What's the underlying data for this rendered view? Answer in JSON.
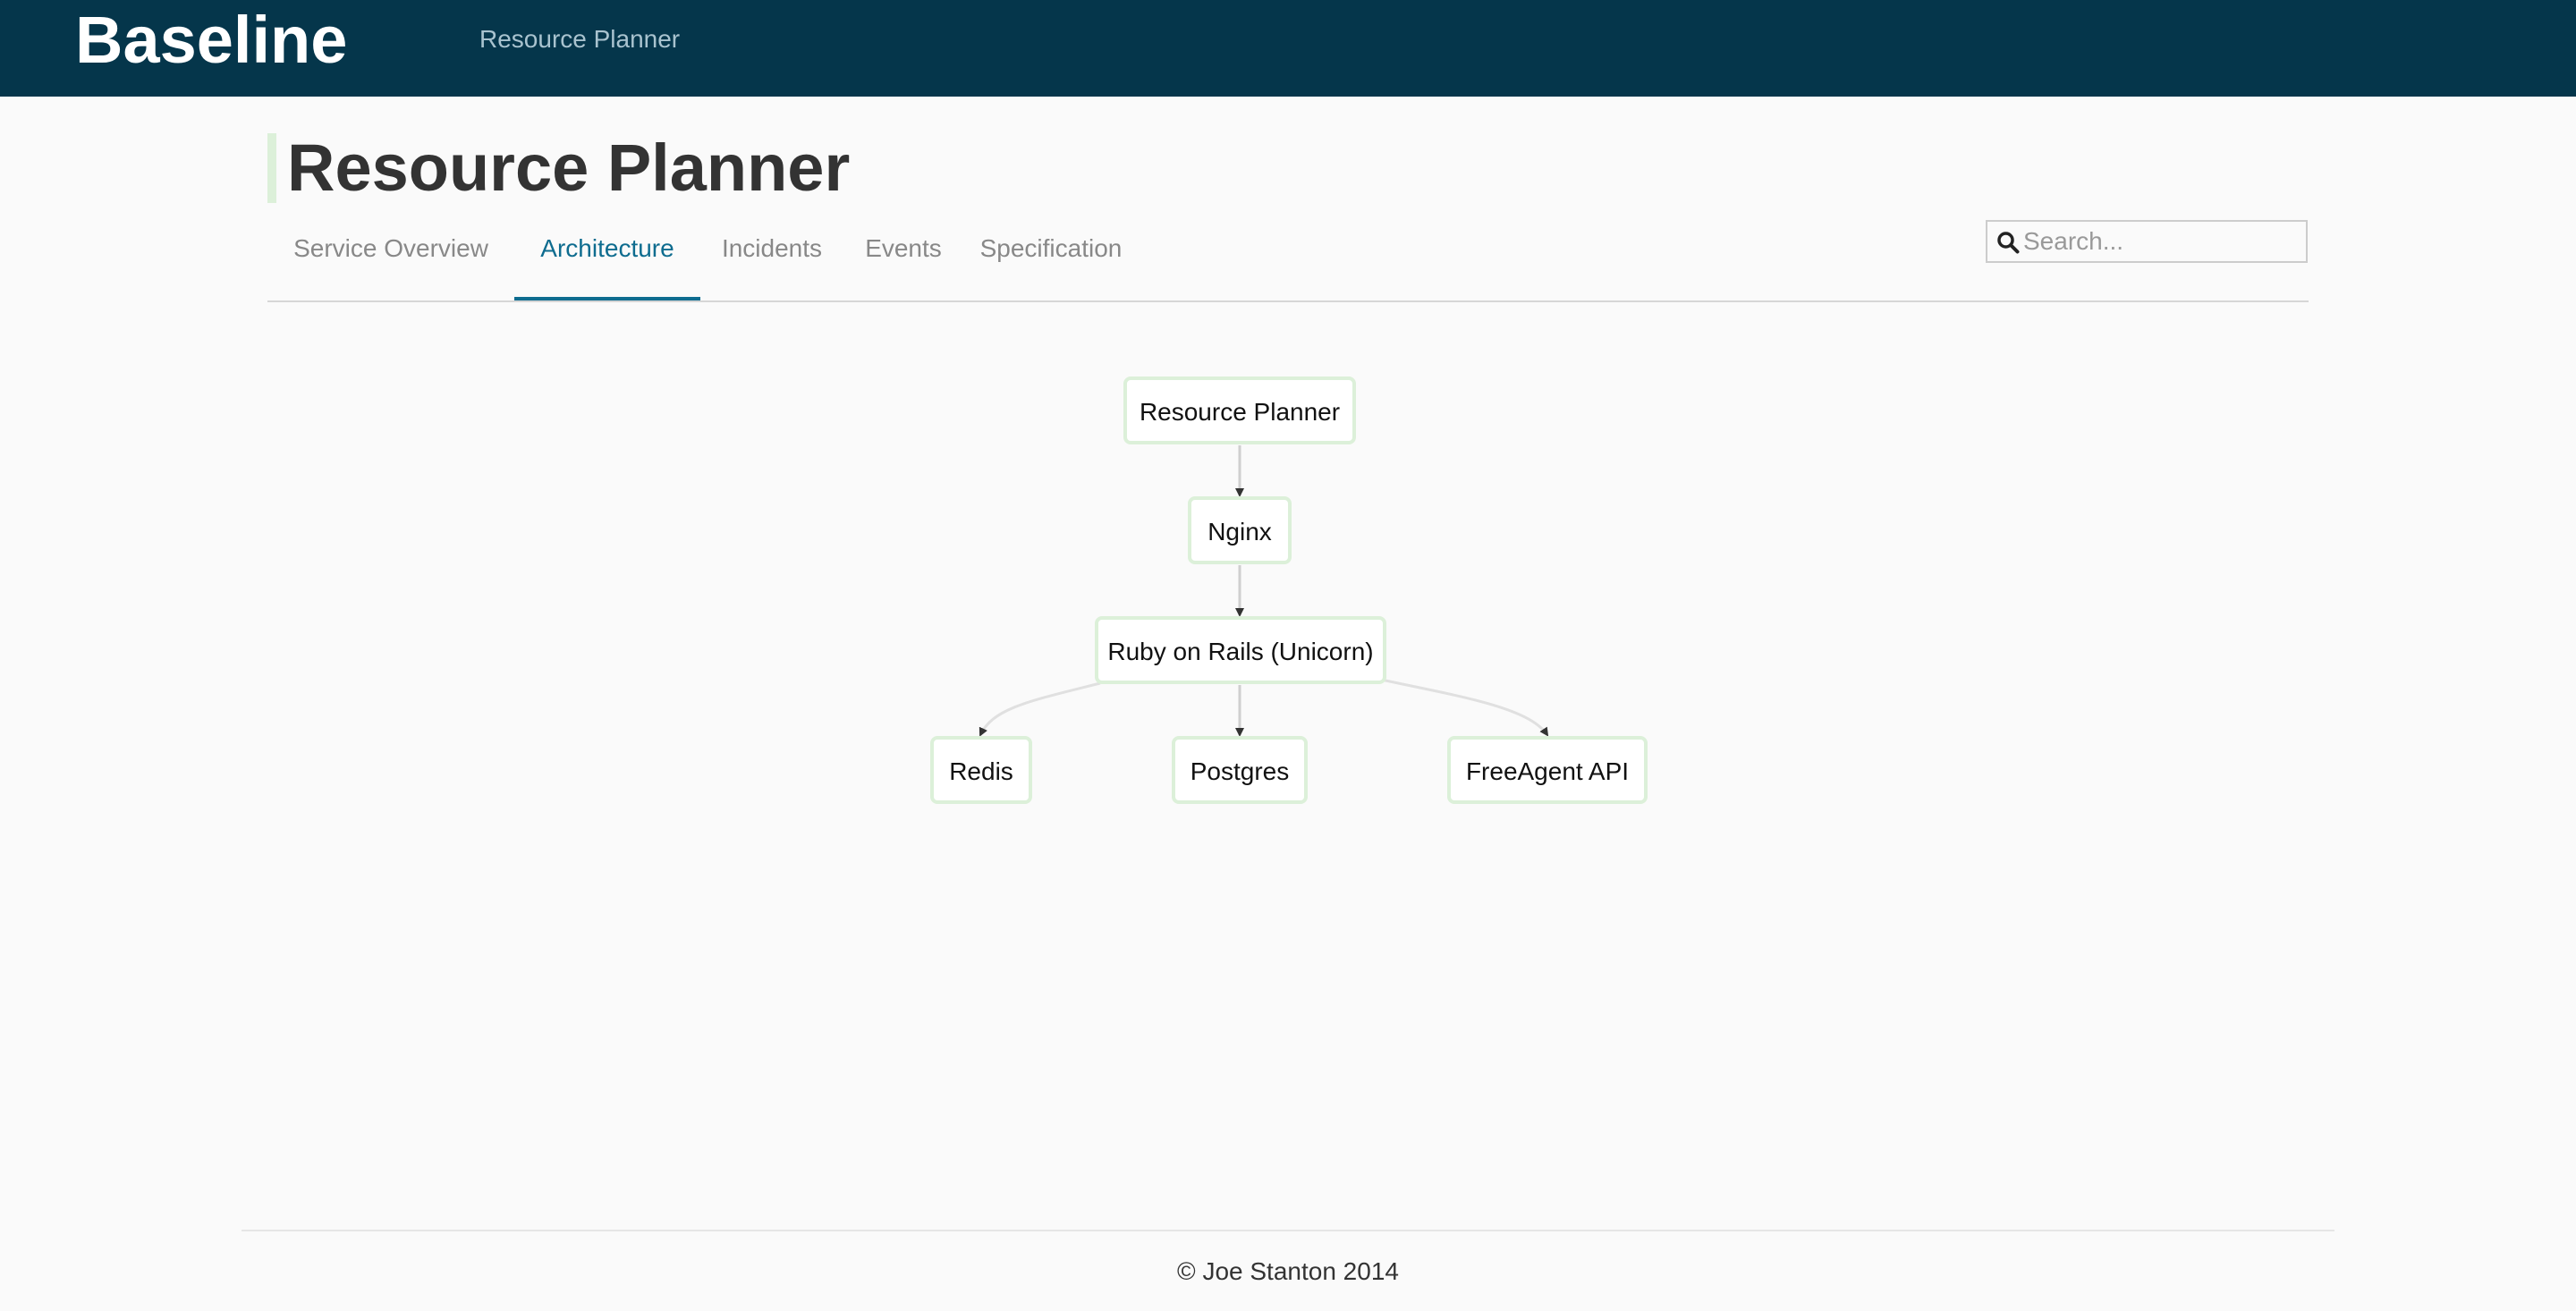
{
  "app": {
    "brand": "Baseline",
    "nav_link": "Resource Planner"
  },
  "page": {
    "title": "Resource Planner"
  },
  "tabs": [
    {
      "label": "Service Overview",
      "active": false
    },
    {
      "label": "Architecture",
      "active": true
    },
    {
      "label": "Incidents",
      "active": false
    },
    {
      "label": "Events",
      "active": false
    },
    {
      "label": "Specification",
      "active": false
    }
  ],
  "search": {
    "placeholder": "Search...",
    "value": ""
  },
  "diagram": {
    "nodes": {
      "resource_planner": "Resource Planner",
      "nginx": "Nginx",
      "rails": "Ruby on Rails (Unicorn)",
      "redis": "Redis",
      "postgres": "Postgres",
      "freeagent": "FreeAgent API"
    },
    "edges": [
      [
        "Resource Planner",
        "Nginx"
      ],
      [
        "Nginx",
        "Ruby on Rails (Unicorn)"
      ],
      [
        "Ruby on Rails (Unicorn)",
        "Redis"
      ],
      [
        "Ruby on Rails (Unicorn)",
        "Postgres"
      ],
      [
        "Ruby on Rails (Unicorn)",
        "FreeAgent API"
      ]
    ]
  },
  "footer": {
    "copyright": "© Joe Stanton 2014"
  },
  "colors": {
    "topbar": "#05364b",
    "accent": "#0e6c8f",
    "node_border": "#dcf0d9"
  }
}
